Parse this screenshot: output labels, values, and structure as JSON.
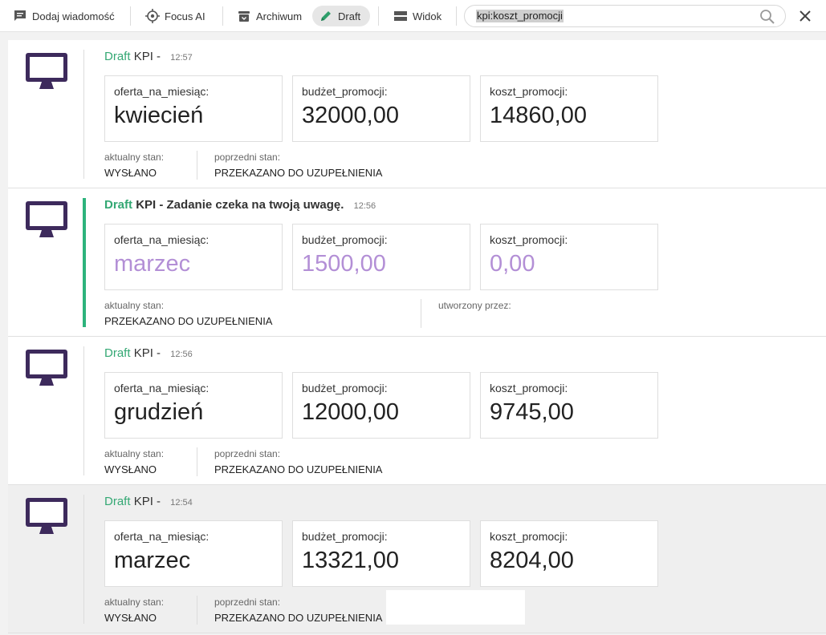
{
  "toolbar": {
    "add_message": "Dodaj wiadomość",
    "focus_ai": "Focus AI",
    "archive": "Archiwum",
    "draft": "Draft",
    "view": "Widok"
  },
  "search": {
    "query": "kpi:koszt_promocji"
  },
  "colors": {
    "accent_green": "#2db37c",
    "draft_text": "#34a874",
    "avatar_purple": "#3d2a5c",
    "highlight_purple": "#b38fd6"
  },
  "messages": [
    {
      "draft": "Draft",
      "title": "KPI -",
      "time": "12:57",
      "fields": [
        {
          "label": "oferta_na_miesiąc:",
          "value": "kwiecień"
        },
        {
          "label": "budżet_promocji:",
          "value": "32000,00"
        },
        {
          "label": "koszt_promocji:",
          "value": "14860,00"
        }
      ],
      "status1_label": "aktualny stan:",
      "status1_value": "WYSŁANO",
      "status2_label": "poprzedni stan:",
      "status2_value": "PRZEKAZANO DO UZUPEŁNIENIA"
    },
    {
      "draft": "Draft",
      "title": "KPI - Zadanie czeka na twoją uwagę.",
      "time": "12:56",
      "fields": [
        {
          "label": "oferta_na_miesiąc:",
          "value": "marzec"
        },
        {
          "label": "budżet_promocji:",
          "value": "1500,00"
        },
        {
          "label": "koszt_promocji:",
          "value": "0,00"
        }
      ],
      "status1_label": "aktualny stan:",
      "status1_value": "PRZEKAZANO DO UZUPEŁNIENIA",
      "status2_label": "utworzony przez:",
      "status2_value": ""
    },
    {
      "draft": "Draft",
      "title": "KPI -",
      "time": "12:56",
      "fields": [
        {
          "label": "oferta_na_miesiąc:",
          "value": "grudzień"
        },
        {
          "label": "budżet_promocji:",
          "value": "12000,00"
        },
        {
          "label": "koszt_promocji:",
          "value": "9745,00"
        }
      ],
      "status1_label": "aktualny stan:",
      "status1_value": "WYSŁANO",
      "status2_label": "poprzedni stan:",
      "status2_value": "PRZEKAZANO DO UZUPEŁNIENIA"
    },
    {
      "draft": "Draft",
      "title": "KPI -",
      "time": "12:54",
      "fields": [
        {
          "label": "oferta_na_miesiąc:",
          "value": "marzec"
        },
        {
          "label": "budżet_promocji:",
          "value": "13321,00"
        },
        {
          "label": "koszt_promocji:",
          "value": "8204,00"
        }
      ],
      "status1_label": "aktualny stan:",
      "status1_value": "WYSŁANO",
      "status2_label": "poprzedni stan:",
      "status2_value": "PRZEKAZANO DO UZUPEŁNIENIA"
    }
  ]
}
